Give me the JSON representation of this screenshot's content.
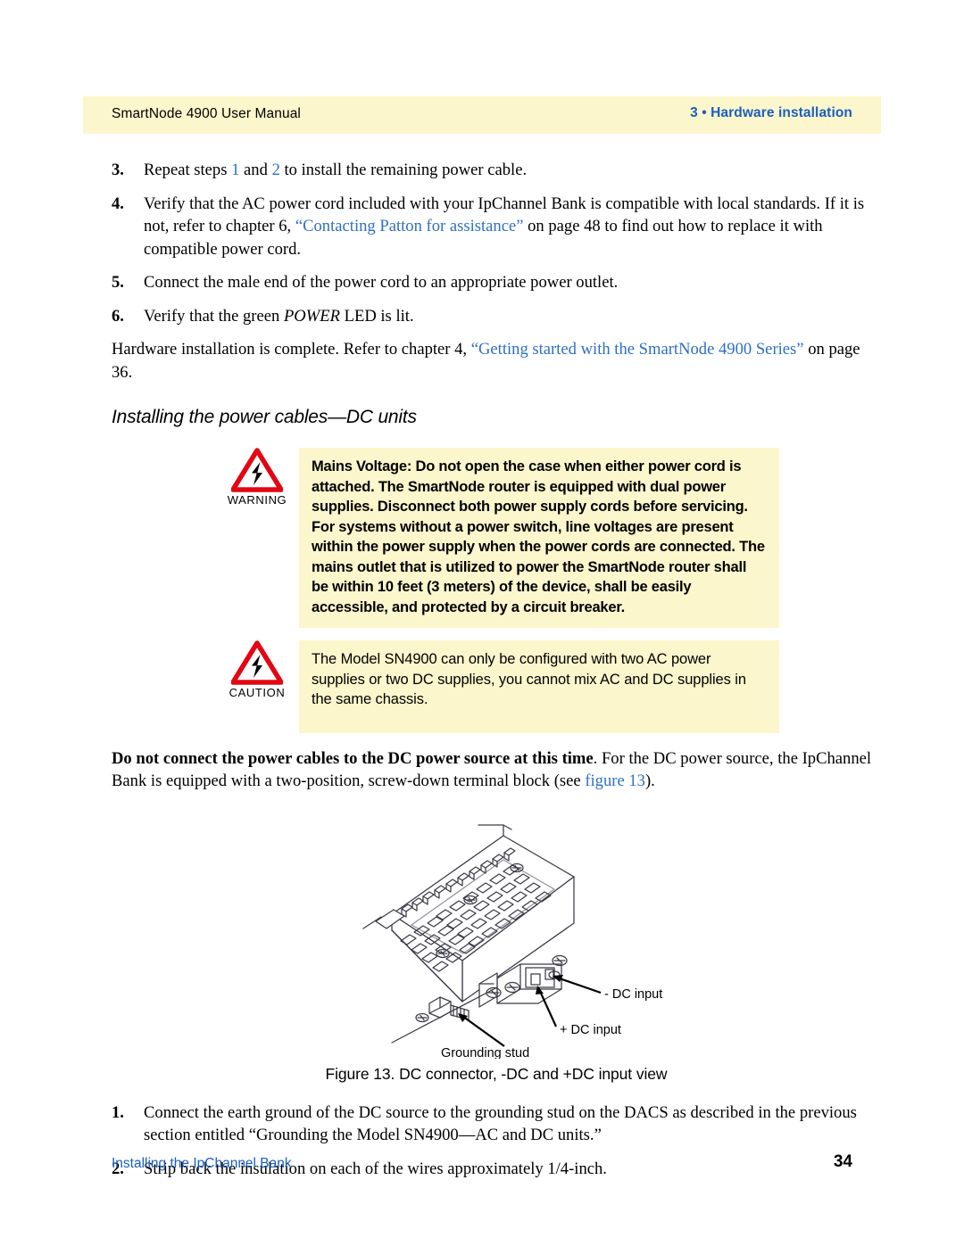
{
  "header": {
    "left_title": "SmartNode 4900 User Manual",
    "right_title": "3 • Hardware installation",
    "band_color": "#fcf6cc",
    "accent_blue": "#1a5fbf"
  },
  "steps_top": [
    {
      "number": "3.",
      "parts": [
        {
          "text": "Repeat steps ",
          "style": "normal"
        },
        {
          "text": "1",
          "style": "link"
        },
        {
          "text": " and ",
          "style": "normal"
        },
        {
          "text": "2",
          "style": "link"
        },
        {
          "text": " to install the remaining power cable.",
          "style": "normal"
        }
      ]
    },
    {
      "number": "4.",
      "parts": [
        {
          "text": "Verify that the AC power cord included with your IpChannel Bank is compatible with local standards. If it is not, refer to chapter 6, ",
          "style": "normal"
        },
        {
          "text": "“Contacting Patton for assistance”",
          "style": "link"
        },
        {
          "text": " on page 48 to find out how to replace it with compatible power cord.",
          "style": "normal"
        }
      ]
    },
    {
      "number": "5.",
      "parts": [
        {
          "text": "Connect the male end of the power cord to an appropriate power outlet.",
          "style": "normal"
        }
      ]
    },
    {
      "number": "6.",
      "parts": [
        {
          "text": "Verify that the green ",
          "style": "normal"
        },
        {
          "text": "POWER",
          "style": "italic"
        },
        {
          "text": " LED is lit.",
          "style": "normal"
        }
      ]
    }
  ],
  "paragraph_complete": [
    {
      "text": "Hardware installation is complete. Refer to chapter 4, ",
      "style": "normal"
    },
    {
      "text": "“Getting started with the SmartNode 4900 Series”",
      "style": "link"
    },
    {
      "text": " on page 36.",
      "style": "normal"
    }
  ],
  "section_heading": "Installing the power cables—DC units",
  "warning": {
    "label": "WARNING",
    "icon": "warning-triangle-lightning-icon",
    "text": "Mains Voltage: Do not open the case when either power cord is attached. The SmartNode router is equipped with dual power supplies. Disconnect both power supply cords before servicing. For systems without a power switch, line voltages are present within the power supply when the power cords are connected. The mains outlet that is utilized to power the SmartNode router shall be within 10 feet (3 meters) of the device, shall be easily accessible, and protected by a circuit breaker.",
    "triangle_color": "#e30613",
    "background": "#fcf6cc"
  },
  "caution": {
    "label": "CAUTION",
    "icon": "caution-triangle-lightning-icon",
    "text": "The Model SN4900 can only be configured with two AC power supplies or two DC supplies, you cannot mix AC and DC supplies in the same chassis.",
    "triangle_color": "#e30613",
    "background": "#fcf6cc"
  },
  "paragraph_dc": [
    {
      "text": "Do not connect the power cables to the DC power source at this time",
      "style": "bold"
    },
    {
      "text": ". For the DC power source, the IpChannel Bank is equipped with a two-position, screw-down terminal block (see ",
      "style": "normal"
    },
    {
      "text": "figure 13",
      "style": "link"
    },
    {
      "text": ").",
      "style": "normal"
    }
  ],
  "figure": {
    "caption": "Figure 13. DC connector, -DC and +DC input view",
    "callouts": {
      "minus_dc": "- DC input",
      "plus_dc": "+ DC input",
      "grounding_stud": "Grounding stud"
    }
  },
  "steps_bottom": [
    {
      "number": "1.",
      "parts": [
        {
          "text": "Connect the earth ground of the DC source to the grounding stud on the DACS as described in the previous section entitled “Grounding the Model SN4900—AC and DC units.”",
          "style": "normal"
        }
      ]
    },
    {
      "number": "2.",
      "parts": [
        {
          "text": "Strip back the insulation on each of the wires approximately 1/4-inch.",
          "style": "normal"
        }
      ]
    }
  ],
  "footer": {
    "left": "Installing the IpChannel Bank",
    "page_number": "34"
  }
}
